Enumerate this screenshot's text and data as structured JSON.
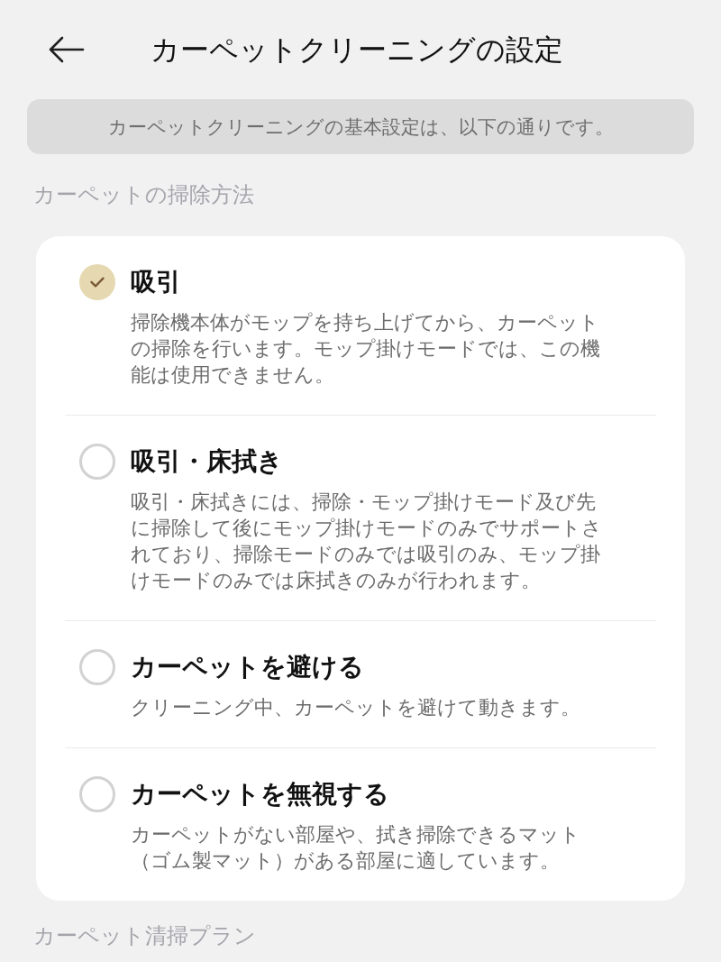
{
  "header": {
    "title": "カーペットクリーニングの設定"
  },
  "notice": "カーペットクリーニングの基本設定は、以下の通りです。",
  "sections": [
    {
      "label": "カーペットの掃除方法",
      "options": [
        {
          "title": "吸引",
          "description": "掃除機本体がモップを持ち上げてから、カーペットの掃除を行います。モップ掛けモードでは、この機能は使用できません。",
          "selected": true
        },
        {
          "title": "吸引・床拭き",
          "description": "吸引・床拭きには、掃除・モップ掛けモード及び先に掃除して後にモップ掛けモードのみでサポートされており、掃除モードのみでは吸引のみ、モップ掛けモードのみでは床拭きのみが行われます。",
          "selected": false
        },
        {
          "title": "カーペットを避ける",
          "description": "クリーニング中、カーペットを避けて動きます。",
          "selected": false
        },
        {
          "title": "カーペットを無視する",
          "description": "カーペットがない部屋や、拭き掃除できるマット（ゴム製マット）がある部屋に適しています。",
          "selected": false
        }
      ]
    },
    {
      "label": "カーペット清掃プラン"
    }
  ]
}
